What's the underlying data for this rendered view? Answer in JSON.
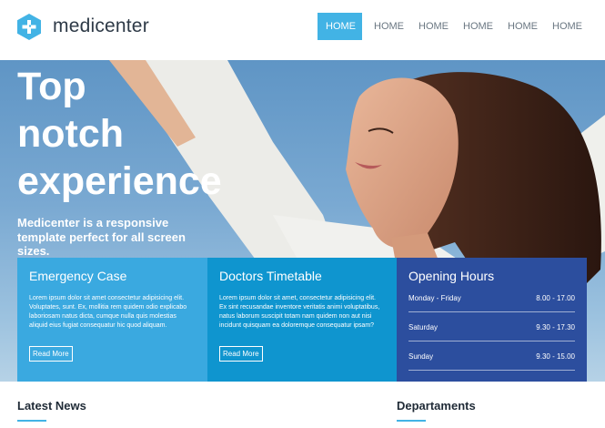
{
  "brand": {
    "name": "medicenter"
  },
  "nav": {
    "items": [
      {
        "label": "HOME",
        "active": true
      },
      {
        "label": "HOME",
        "active": false
      },
      {
        "label": "HOME",
        "active": false
      },
      {
        "label": "HOME",
        "active": false
      },
      {
        "label": "HOME",
        "active": false
      },
      {
        "label": "HOME",
        "active": false
      }
    ]
  },
  "hero": {
    "title_line1": "Top",
    "title_line2": "notch",
    "title_line3": "experience",
    "subtitle": "Medicenter is a responsive template perfect for all screen sizes."
  },
  "boxes": {
    "emergency": {
      "title": "Emergency Case",
      "text": "Lorem ipsum dolor sit amet consectetur adipisicing elit. Voluptates, sunt. Ex, mollitia rem quidem odio explicabo laboriosam natus dicta, cumque nulla quis molestias aliquid eius fugiat consequatur hic quod aliquam.",
      "button": "Read More"
    },
    "timetable": {
      "title": "Doctors Timetable",
      "text": "Lorem ipsum dolor sit amet, consectetur adipisicing elit. Ex sint recusandae inventore veritatis animi voluptatibus, natus laborum suscipit totam nam quidem non aut nisi incidunt quisquam ea doloremque consequatur ipsam?",
      "button": "Read More"
    },
    "hours": {
      "title": "Opening Hours",
      "rows": [
        {
          "day": "Monday - Friday",
          "time": "8.00 - 17.00"
        },
        {
          "day": "Saturday",
          "time": "9.30 - 17.30"
        },
        {
          "day": "Sunday",
          "time": "9.30 - 15.00"
        }
      ]
    }
  },
  "sections": {
    "latest_news": "Latest News",
    "departaments": "Departaments"
  },
  "colors": {
    "accent": "#42b3e5",
    "box1": "#3aa9e0",
    "box2": "#0f95cf",
    "box3": "#2c4e9e"
  },
  "icons": {
    "logo": "cross-hexagon-icon"
  }
}
